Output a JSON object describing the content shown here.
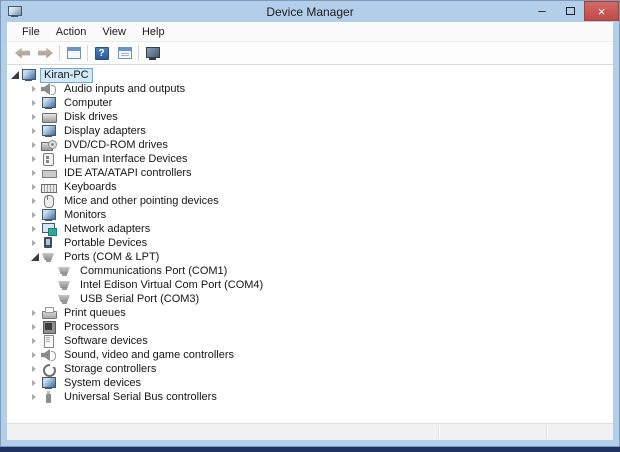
{
  "window": {
    "title": "Device Manager",
    "controls": {
      "minimize": "–",
      "maximize": "□",
      "close": "×"
    }
  },
  "menu": {
    "items": [
      "File",
      "Action",
      "View",
      "Help"
    ]
  },
  "toolbar": {
    "items": [
      {
        "type": "button",
        "name": "back"
      },
      {
        "type": "button",
        "name": "forward"
      },
      {
        "type": "separator"
      },
      {
        "type": "button",
        "name": "console-tree"
      },
      {
        "type": "separator"
      },
      {
        "type": "button",
        "name": "help",
        "glyph": "?"
      },
      {
        "type": "button",
        "name": "properties"
      },
      {
        "type": "separator"
      },
      {
        "type": "button",
        "name": "scan"
      }
    ]
  },
  "tree": {
    "items": [
      {
        "label": "Kiran-PC",
        "icon": "computer",
        "level": 0,
        "state": "expanded",
        "selected": true
      },
      {
        "label": "Audio inputs and outputs",
        "icon": "audio",
        "level": 1,
        "state": "collapsed"
      },
      {
        "label": "Computer",
        "icon": "computer",
        "level": 1,
        "state": "collapsed"
      },
      {
        "label": "Disk drives",
        "icon": "disk",
        "level": 1,
        "state": "collapsed"
      },
      {
        "label": "Display adapters",
        "icon": "display",
        "level": 1,
        "state": "collapsed"
      },
      {
        "label": "DVD/CD-ROM drives",
        "icon": "cd-drive",
        "level": 1,
        "state": "collapsed"
      },
      {
        "label": "Human Interface Devices",
        "icon": "hid",
        "level": 1,
        "state": "collapsed"
      },
      {
        "label": "IDE ATA/ATAPI controllers",
        "icon": "ide",
        "level": 1,
        "state": "collapsed"
      },
      {
        "label": "Keyboards",
        "icon": "keyboard",
        "level": 1,
        "state": "collapsed"
      },
      {
        "label": "Mice and other pointing devices",
        "icon": "mouse",
        "level": 1,
        "state": "collapsed"
      },
      {
        "label": "Monitors",
        "icon": "monitor",
        "level": 1,
        "state": "collapsed"
      },
      {
        "label": "Network adapters",
        "icon": "network",
        "level": 1,
        "state": "collapsed"
      },
      {
        "label": "Portable Devices",
        "icon": "portable",
        "level": 1,
        "state": "collapsed"
      },
      {
        "label": "Ports (COM & LPT)",
        "icon": "port",
        "level": 1,
        "state": "expanded"
      },
      {
        "label": "Communications Port (COM1)",
        "icon": "port",
        "level": 2,
        "state": null
      },
      {
        "label": "Intel Edison Virtual Com Port (COM4)",
        "icon": "port",
        "level": 2,
        "state": null
      },
      {
        "label": "USB Serial Port (COM3)",
        "icon": "port",
        "level": 2,
        "state": null
      },
      {
        "label": "Print queues",
        "icon": "printer",
        "level": 1,
        "state": "collapsed"
      },
      {
        "label": "Processors",
        "icon": "processor",
        "level": 1,
        "state": "collapsed"
      },
      {
        "label": "Software devices",
        "icon": "software",
        "level": 1,
        "state": "collapsed"
      },
      {
        "label": "Sound, video and game controllers",
        "icon": "sound",
        "level": 1,
        "state": "collapsed"
      },
      {
        "label": "Storage controllers",
        "icon": "storage",
        "level": 1,
        "state": "collapsed"
      },
      {
        "label": "System devices",
        "icon": "system",
        "level": 1,
        "state": "collapsed"
      },
      {
        "label": "Universal Serial Bus controllers",
        "icon": "usb",
        "level": 1,
        "state": "collapsed"
      }
    ]
  },
  "statusbar": {
    "panes": [
      "",
      "",
      ""
    ]
  },
  "colors": {
    "titlebar": "#b2cee9",
    "close_button": "#c14a48",
    "selection_bg": "#d3e9f9",
    "selection_border": "#70a8d4",
    "help_icon": "#2d5a95",
    "desktop_strip": "#1d3260"
  }
}
